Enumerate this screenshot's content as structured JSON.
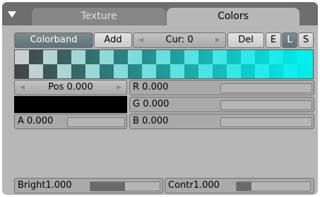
{
  "tabs": {
    "texture_label": "Texture",
    "colors_label": "Colors"
  },
  "toolbar": {
    "colorband_label": "Colorband",
    "add_label": "Add",
    "cur_label": "Cur: 0",
    "del_label": "Del",
    "e_label": "E",
    "l_label": "L",
    "s_label": "S"
  },
  "colorband": {
    "start_color": "#00d2d2",
    "end_color": "#00f0f0"
  },
  "pos": {
    "label": "Pos 0.000",
    "value": 0.0
  },
  "swatch_color": "#000000",
  "alpha": {
    "label": "A 0.000",
    "value": 0.0
  },
  "rgb": {
    "r": {
      "label": "R 0.000",
      "value": 0.0
    },
    "g": {
      "label": "G 0.000",
      "value": 0.0
    },
    "b": {
      "label": "B 0.000",
      "value": 0.0
    }
  },
  "bright": {
    "label": "Bright1.000",
    "value": 0.5
  },
  "contr": {
    "label": "Contr1.000",
    "value": 0.2
  },
  "icons": {
    "collapse": "triangle-down-icon",
    "decrement": "arrow-left-icon",
    "increment": "arrow-right-icon"
  }
}
